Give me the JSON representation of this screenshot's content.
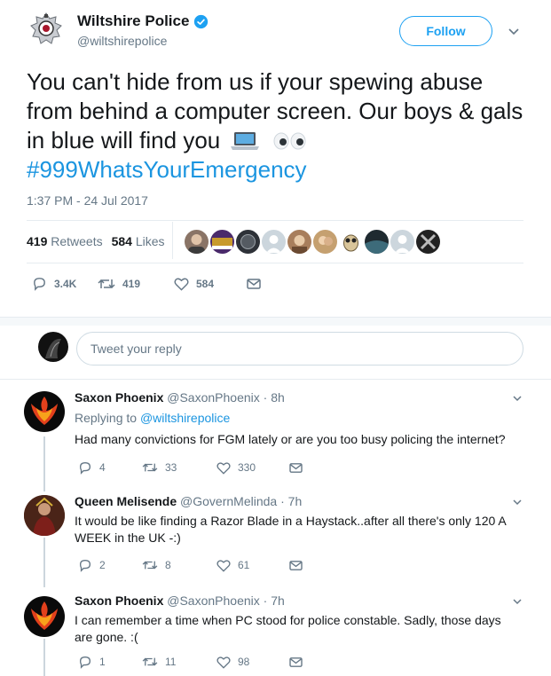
{
  "author": {
    "name": "Wiltshire Police",
    "handle": "@wiltshirepolice",
    "follow_label": "Follow"
  },
  "tweet": {
    "text_line": "You can't hide from us if your spewing abuse from behind a computer screen. Our boys & gals in blue will find you",
    "hashtag": "#999WhatsYourEmergency",
    "timestamp": "1:37 PM - 24 Jul 2017",
    "retweets_count": "419",
    "retweets_label": "Retweets",
    "likes_count": "584",
    "likes_label": "Likes",
    "actions": {
      "replies": "3.4K",
      "retweets": "419",
      "likes": "584"
    }
  },
  "reply_box": {
    "placeholder": "Tweet your reply"
  },
  "replies": [
    {
      "name": "Saxon Phoenix",
      "handle": "@SaxonPhoenix",
      "time": "8h",
      "replying_prefix": "Replying to",
      "replying_to": "@wiltshirepolice",
      "text": "Had many convictions for FGM lately or are you too busy policing the internet?",
      "replies": "4",
      "retweets": "33",
      "likes": "330"
    },
    {
      "name": "Queen Melisende",
      "handle": "@GovernMelinda",
      "time": "7h",
      "text": "It would be like finding a Razor Blade in a Haystack..after all there's only 120 A WEEK in the UK -:)",
      "replies": "2",
      "retweets": "8",
      "likes": "61"
    },
    {
      "name": "Saxon Phoenix",
      "handle": "@SaxonPhoenix",
      "time": "7h",
      "text": "I can remember a time when PC stood for police constable. Sadly, those days are gone. :(",
      "replies": "1",
      "retweets": "11",
      "likes": "98"
    }
  ],
  "colors": {
    "accent": "#1da1f2",
    "link": "#1b95e0",
    "muted": "#657786",
    "divider": "#e6ecf0"
  },
  "icons": [
    "police-badge-icon",
    "verified-icon",
    "chevron-down-icon",
    "laptop-emoji-icon",
    "eyes-emoji-icon",
    "reply-icon",
    "retweet-icon",
    "like-icon",
    "direct-message-icon"
  ]
}
